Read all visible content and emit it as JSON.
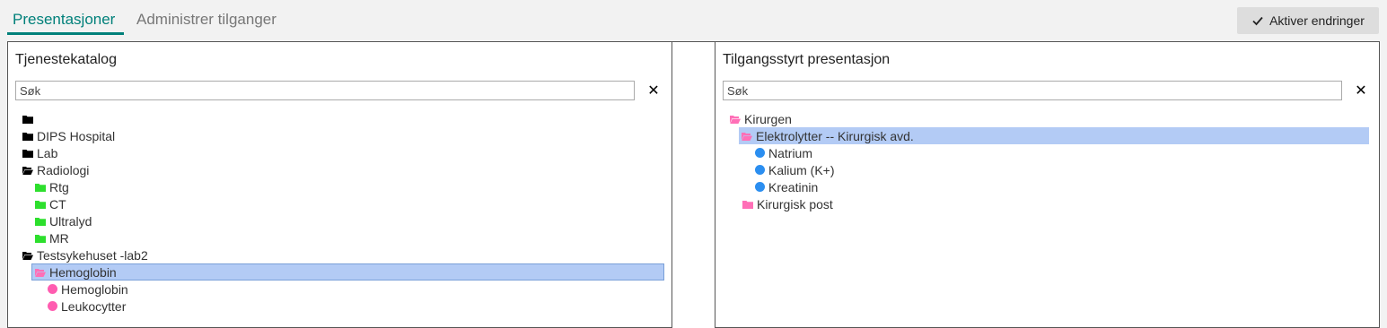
{
  "tabs": [
    {
      "label": "Presentasjoner",
      "active": true
    },
    {
      "label": "Administrer tilganger",
      "active": false
    }
  ],
  "activate_button": {
    "label": "Aktiver endringer",
    "icon": "check-icon"
  },
  "colors": {
    "accent": "#00807a",
    "folder_black": "#000000",
    "folder_green": "#2ddf2d",
    "folder_pink": "#ff6fb7",
    "dot_pink": "#ff5cb0",
    "dot_blue": "#2b8ef0",
    "selection": "#b3cbf5"
  },
  "left_panel": {
    "title": "Tjenestekatalog",
    "search_placeholder": "Søk",
    "clear_label": "✕",
    "tree": [
      {
        "label": "",
        "icon": "folder-closed-icon",
        "color": "black"
      },
      {
        "label": "DIPS Hospital",
        "icon": "folder-closed-icon",
        "color": "black"
      },
      {
        "label": "Lab",
        "icon": "folder-closed-icon",
        "color": "black"
      },
      {
        "label": "Radiologi",
        "icon": "folder-open-icon",
        "color": "black"
      },
      {
        "label": "Rtg",
        "icon": "folder-closed-icon",
        "color": "green"
      },
      {
        "label": "CT",
        "icon": "folder-closed-icon",
        "color": "green"
      },
      {
        "label": "Ultralyd",
        "icon": "folder-closed-icon",
        "color": "green"
      },
      {
        "label": "MR",
        "icon": "folder-closed-icon",
        "color": "green"
      },
      {
        "label": "Testsykehuset -lab2",
        "icon": "folder-open-icon",
        "color": "black"
      },
      {
        "label": "Hemoglobin",
        "icon": "folder-open-icon",
        "color": "pink",
        "selected": true
      },
      {
        "label": "Hemoglobin",
        "icon": "dot-icon",
        "color": "pink"
      },
      {
        "label": "Leukocytter",
        "icon": "dot-icon",
        "color": "pink"
      }
    ]
  },
  "right_panel": {
    "title": "Tilgangsstyrt presentasjon",
    "search_placeholder": "Søk",
    "clear_label": "✕",
    "tree": [
      {
        "label": "Kirurgen",
        "icon": "folder-open-icon",
        "color": "pink"
      },
      {
        "label": "Elektrolytter -- Kirurgisk avd.",
        "icon": "folder-open-icon",
        "color": "pink",
        "selected": true
      },
      {
        "label": "Natrium",
        "icon": "dot-icon",
        "color": "blue"
      },
      {
        "label": "Kalium (K+)",
        "icon": "dot-icon",
        "color": "blue"
      },
      {
        "label": "Kreatinin",
        "icon": "dot-icon",
        "color": "blue"
      },
      {
        "label": "Kirurgisk post",
        "icon": "folder-closed-icon",
        "color": "pink"
      }
    ]
  }
}
